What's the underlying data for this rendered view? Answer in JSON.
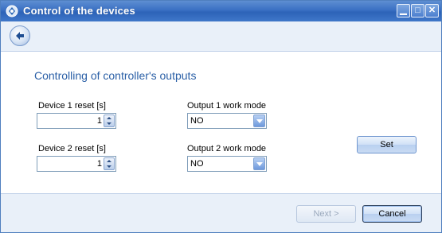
{
  "window": {
    "title": "Control of the devices"
  },
  "titlebar_buttons": {
    "minimize": "▁",
    "maximize": "□",
    "close": "✕"
  },
  "icons": {
    "app": "app-logo-icon",
    "back": "back-arrow-icon",
    "spin_up": "spin-up-icon",
    "spin_down": "spin-down-icon",
    "dropdown": "chevron-down-icon"
  },
  "colors": {
    "heading": "#2a5fa6",
    "titlebar": "#3a70c3"
  },
  "main": {
    "heading": "Controlling of controller's outputs",
    "device1": {
      "label": "Device 1 reset [s]",
      "value": "1"
    },
    "device2": {
      "label": "Device 2 reset [s]",
      "value": "1"
    },
    "output1": {
      "label": "Output 1 work mode",
      "value": "NO"
    },
    "output2": {
      "label": "Output 2 work mode",
      "value": "NO"
    },
    "set_label": "Set"
  },
  "footer": {
    "next_label": "Next >",
    "cancel_label": "Cancel"
  }
}
